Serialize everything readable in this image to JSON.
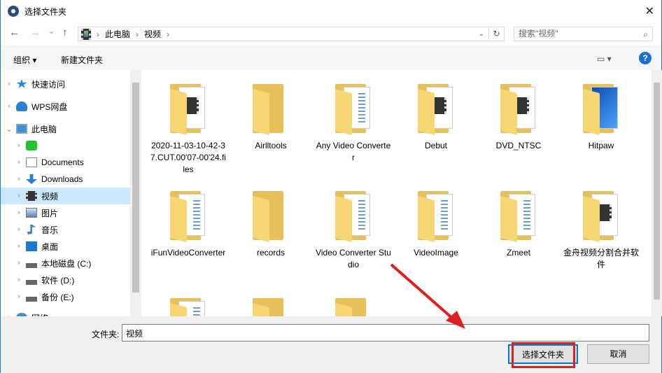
{
  "window": {
    "title": "选择文件夹",
    "close": "✕"
  },
  "nav": {
    "back": "←",
    "forward": "→",
    "recent": "⌄",
    "up": "↑",
    "breadcrumb": [
      "此电脑",
      "视频"
    ],
    "sep": "›",
    "refresh": "↻",
    "search_placeholder": "搜索\"视频\"",
    "search_icon": "⌕"
  },
  "toolbar": {
    "organize": "组织 ▾",
    "new_folder": "新建文件夹",
    "view": "▭ ▾",
    "help": "?"
  },
  "sidebar": [
    {
      "label": "快速访问",
      "icon": "star-icon",
      "level": 0,
      "chev": "›"
    },
    {
      "label": "WPS网盘",
      "icon": "cloud-icon",
      "level": 0,
      "chev": "›"
    },
    {
      "label": "此电脑",
      "icon": "computer-icon",
      "level": 0,
      "chev": "⌄"
    },
    {
      "label": "",
      "icon": "iqiyi-icon",
      "level": 1,
      "chev": "›"
    },
    {
      "label": "Documents",
      "icon": "document-icon",
      "level": 1,
      "chev": "›"
    },
    {
      "label": "Downloads",
      "icon": "download-icon",
      "level": 1,
      "chev": "›"
    },
    {
      "label": "视频",
      "icon": "video-icon",
      "level": 1,
      "chev": "›",
      "selected": true
    },
    {
      "label": "图片",
      "icon": "picture-icon",
      "level": 1,
      "chev": "›"
    },
    {
      "label": "音乐",
      "icon": "music-icon",
      "level": 1,
      "chev": "›"
    },
    {
      "label": "桌面",
      "icon": "desktop-icon",
      "level": 1,
      "chev": "›"
    },
    {
      "label": "本地磁盘 (C:)",
      "icon": "drive-icon",
      "level": 1,
      "chev": "›"
    },
    {
      "label": "软件 (D:)",
      "icon": "drive-icon",
      "level": 1,
      "chev": "›"
    },
    {
      "label": "备份 (E:)",
      "icon": "drive-icon",
      "level": 1,
      "chev": "›"
    },
    {
      "label": "网络",
      "icon": "network-icon",
      "level": 0,
      "chev": "›"
    }
  ],
  "folders": [
    {
      "name": "2020-11-03-10-42-37.CUT.00'07-00'24.files",
      "type": "film"
    },
    {
      "name": "Airlltools",
      "type": "plain"
    },
    {
      "name": "Any Video Converter",
      "type": "lines"
    },
    {
      "name": "Debut",
      "type": "film"
    },
    {
      "name": "DVD_NTSC",
      "type": "film"
    },
    {
      "name": "Hitpaw",
      "type": "win"
    },
    {
      "name": "iFunVideoConverter",
      "type": "lines"
    },
    {
      "name": "records",
      "type": "plain"
    },
    {
      "name": "Video Converter Studio",
      "type": "lines"
    },
    {
      "name": "VideoImage",
      "type": "lines"
    },
    {
      "name": "Zmeet",
      "type": "lines"
    },
    {
      "name": "金舟视频分割合并软件",
      "type": "film"
    },
    {
      "name": "",
      "type": "lines"
    },
    {
      "name": "",
      "type": "plain"
    },
    {
      "name": "",
      "type": "plain"
    }
  ],
  "bottom": {
    "folder_label": "文件夹:",
    "folder_value": "视频",
    "select_button": "选择文件夹",
    "cancel_button": "取消"
  },
  "colors": {
    "accent": "#0078d7",
    "selected": "#cce8ff",
    "annotation": "#e02020"
  }
}
